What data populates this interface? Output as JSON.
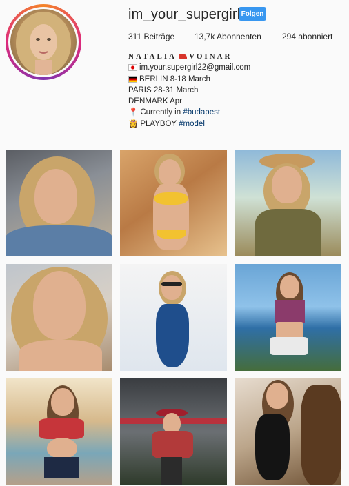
{
  "profile": {
    "username": "im_your_supergirl",
    "follow_label": "Folgen",
    "stats": {
      "posts": "311 Beiträge",
      "followers": "13,7k Abonnenten",
      "following": "294 abonniert"
    },
    "bio": {
      "name_left": "NATALIA",
      "name_right": "VOINAR",
      "email": "im.your.supergirl22@gmail.com",
      "line_berlin": "BERLIN 8-18 March",
      "line_paris": "PARIS 28-31 March",
      "line_denmark": "DENMARK Apr",
      "currently_prefix": "Currently in ",
      "currently_tag": "#budapest",
      "playboy_prefix": "PLAYBOY ",
      "playboy_tag": "#model"
    }
  },
  "grid": {
    "posts": [
      {
        "subject": "selfie in car, denim jacket"
      },
      {
        "subject": "yellow bikini on rocks"
      },
      {
        "subject": "cowboy hat, khaki shirt"
      },
      {
        "subject": "close-up portrait"
      },
      {
        "subject": "blue swimsuit, sunglasses"
      },
      {
        "subject": "sea cliff, crop top"
      },
      {
        "subject": "pool, red plaid top"
      },
      {
        "subject": "street, red hat, plaid scarf"
      },
      {
        "subject": "black swimsuit, palm tree"
      }
    ]
  },
  "colors": {
    "follow_button": "#3897f0",
    "hashtag": "#003569",
    "text": "#262626"
  }
}
